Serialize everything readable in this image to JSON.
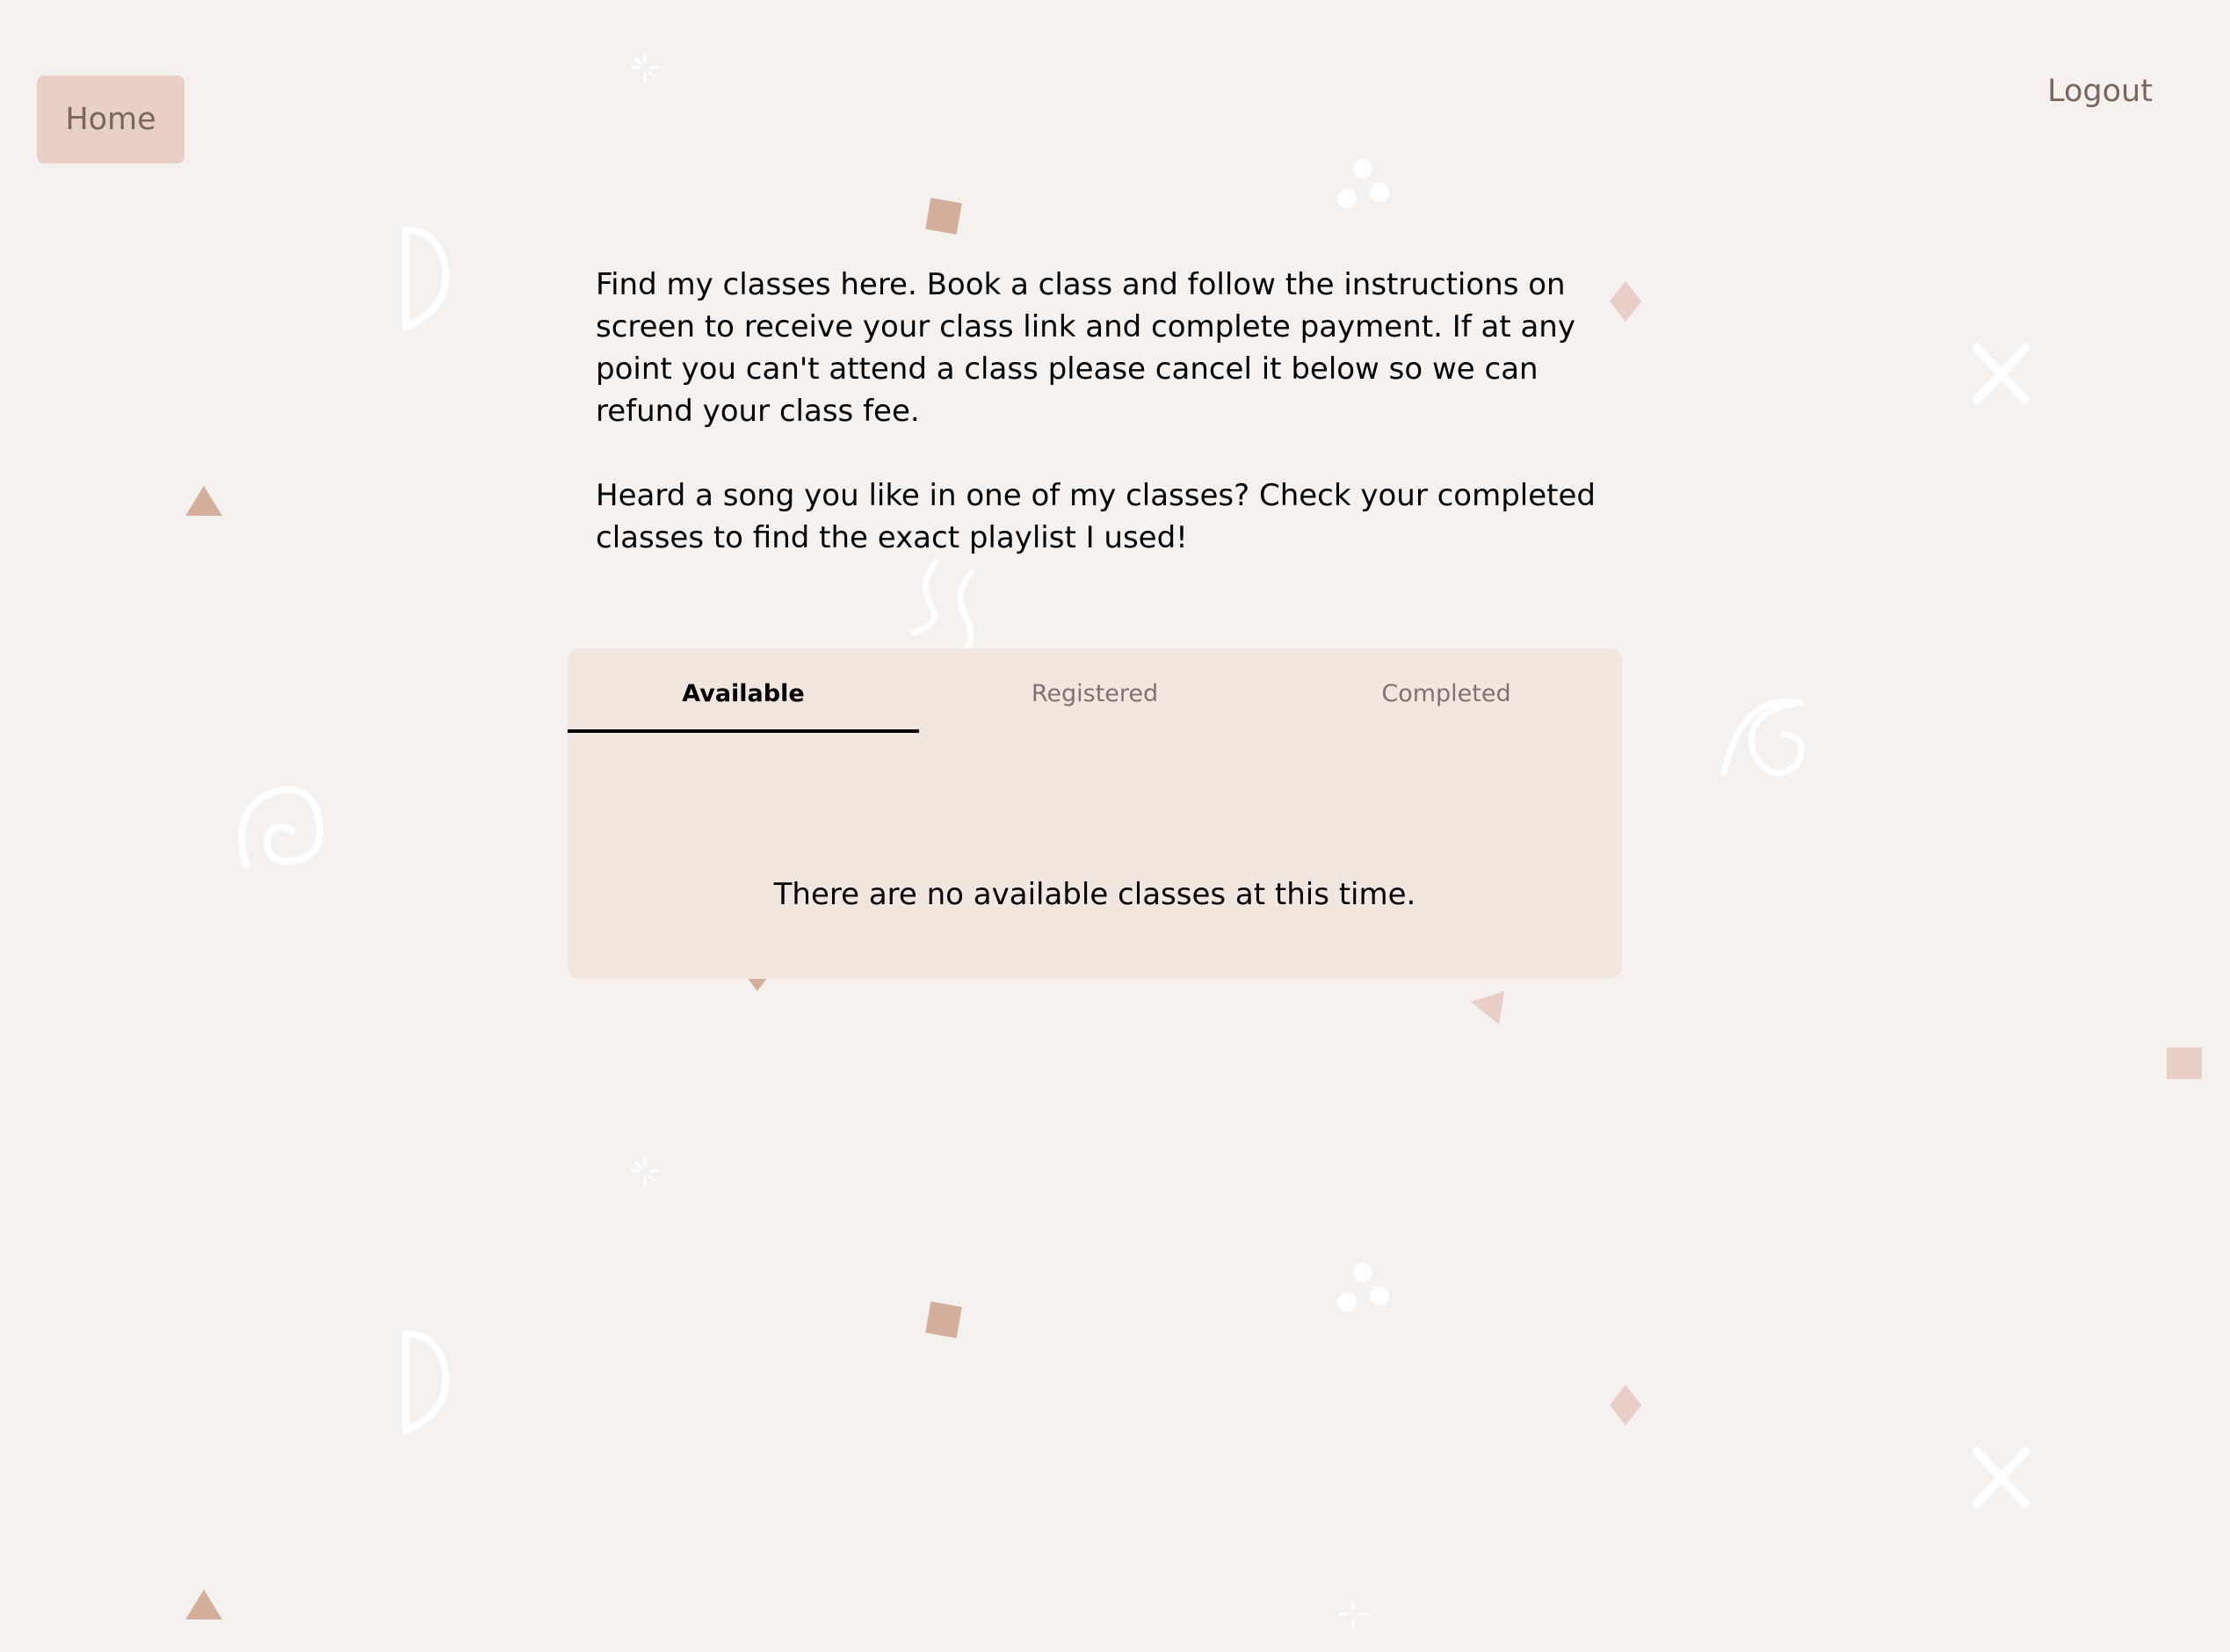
{
  "header": {
    "home_label": "Home",
    "logout_label": "Logout"
  },
  "intro": {
    "paragraph_1": "Find my classes here. Book a class and follow the instructions on screen to receive your class link and complete payment. If at any point you can't attend a class please cancel it below so we can refund your class fee.",
    "paragraph_2": "Heard a song you like in one of my classes? Check your completed classes to find the exact playlist I used!"
  },
  "tabs": [
    {
      "label": "Available",
      "active": true
    },
    {
      "label": "Registered",
      "active": false
    },
    {
      "label": "Completed",
      "active": false
    }
  ],
  "panel": {
    "empty_message": "There are no available classes at this time."
  },
  "colors": {
    "background": "#f5f1ee",
    "panel": "#f1e7df",
    "home_button": "#e8d0c9",
    "muted_text": "#7a675c",
    "decor_tan": "#d4b09c",
    "decor_pink": "#e8cec7",
    "decor_white": "#ffffff"
  }
}
